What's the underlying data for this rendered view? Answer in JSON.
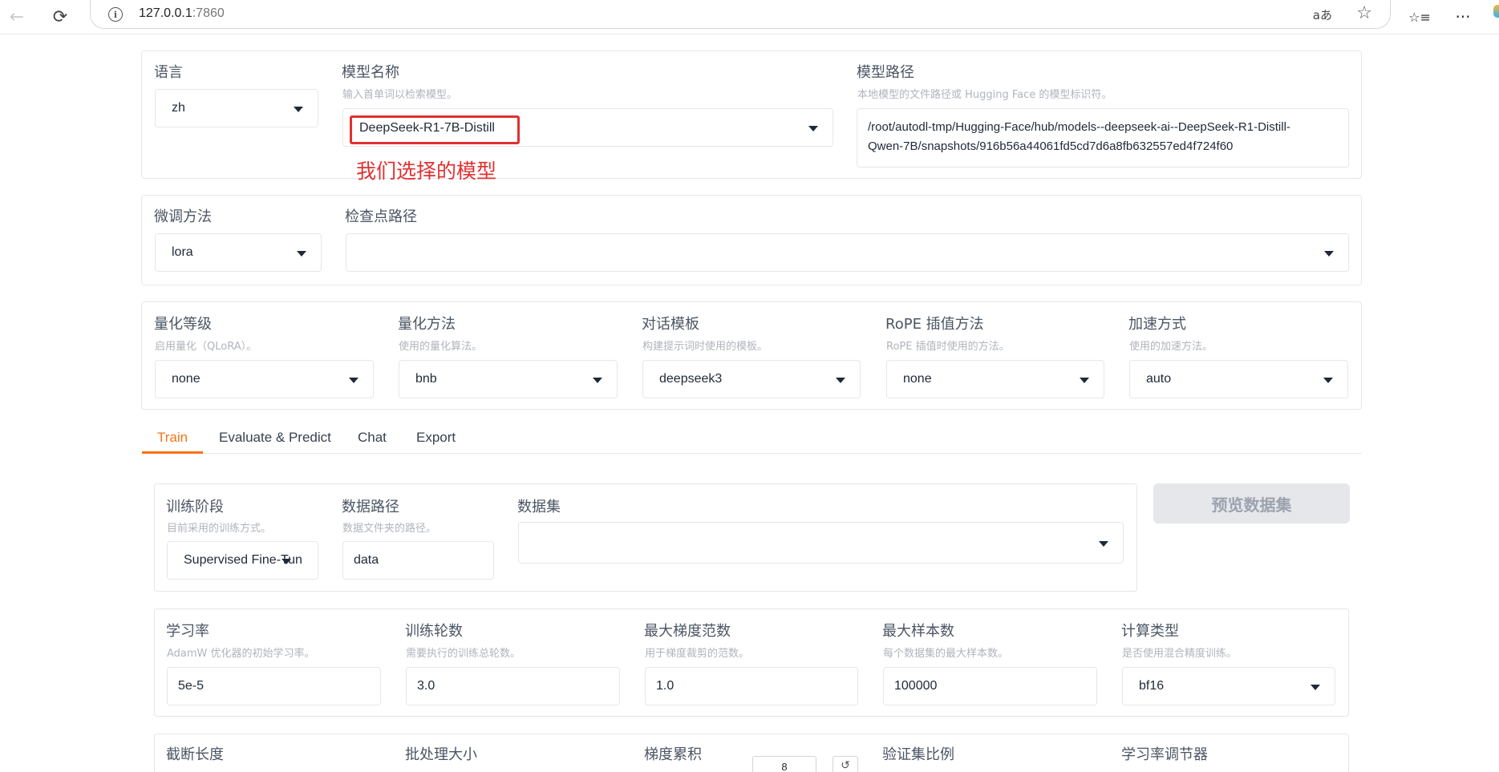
{
  "browser": {
    "url_host": "127.0.0.1",
    "url_port": ":7860",
    "back_glyph": "←",
    "reload_glyph": "⟳",
    "info_glyph": "i",
    "read_aloud_glyph": "aあ",
    "star_glyph": "☆",
    "favorites_glyph": "☆≡",
    "more_glyph": "···"
  },
  "model": {
    "language_label": "语言",
    "language_value": "zh",
    "model_name_label": "模型名称",
    "model_name_info": "输入首单词以检索模型。",
    "model_name_value": "DeepSeek-R1-7B-Distill",
    "model_path_label": "模型路径",
    "model_path_info": "本地模型的文件路径或 Hugging Face 的模型标识符。",
    "model_path_line1": "/root/autodl-tmp/Hugging-Face/hub/models--deepseek-ai--DeepSeek-R1-Distill-",
    "model_path_line2": "Qwen-7B/snapshots/916b56a44061fd5cd7d6a8fb632557ed4f724f60",
    "annotation": "我们选择的模型"
  },
  "finetune": {
    "method_label": "微调方法",
    "method_value": "lora",
    "checkpoint_label": "检查点路径",
    "checkpoint_value": ""
  },
  "advanced": {
    "quant_bit_label": "量化等级",
    "quant_bit_info": "启用量化（QLoRA）。",
    "quant_bit_value": "none",
    "quant_method_label": "量化方法",
    "quant_method_info": "使用的量化算法。",
    "quant_method_value": "bnb",
    "template_label": "对话模板",
    "template_info": "构建提示词时使用的模板。",
    "template_value": "deepseek3",
    "rope_label": "RoPE 插值方法",
    "rope_info": "RoPE 插值时使用的方法。",
    "rope_value": "none",
    "booster_label": "加速方式",
    "booster_info": "使用的加速方法。",
    "booster_value": "auto"
  },
  "tabs": [
    {
      "label": "Train"
    },
    {
      "label": "Evaluate & Predict"
    },
    {
      "label": "Chat"
    },
    {
      "label": "Export"
    }
  ],
  "train": {
    "stage_label": "训练阶段",
    "stage_info": "目前采用的训练方式。",
    "stage_value": "Supervised Fine-Tun",
    "dataset_dir_label": "数据路径",
    "dataset_dir_info": "数据文件夹的路径。",
    "dataset_dir_value": "data",
    "dataset_label": "数据集",
    "dataset_value": "",
    "preview_button": "预览数据集",
    "lr_label": "学习率",
    "lr_info": "AdamW 优化器的初始学习率。",
    "lr_value": "5e-5",
    "epochs_label": "训练轮数",
    "epochs_info": "需要执行的训练总轮数。",
    "epochs_value": "3.0",
    "grad_norm_label": "最大梯度范数",
    "grad_norm_info": "用于梯度裁剪的范数。",
    "grad_norm_value": "1.0",
    "max_samples_label": "最大样本数",
    "max_samples_info": "每个数据集的最大样本数。",
    "max_samples_value": "100000",
    "compute_type_label": "计算类型",
    "compute_type_info": "是否使用混合精度训练。",
    "compute_type_value": "bf16",
    "cutoff_label": "截断长度",
    "batch_label": "批处理大小",
    "grad_accum_label": "梯度累积",
    "grad_accum_value": "8",
    "reset_glyph": "↺",
    "val_size_label": "验证集比例",
    "scheduler_label": "学习率调节器"
  }
}
